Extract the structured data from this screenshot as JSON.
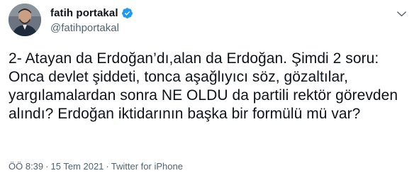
{
  "author": {
    "display_name": "fatih portakal",
    "handle": "@fatihportakal",
    "verified": true,
    "avatar_icon": "profile-photo"
  },
  "tweet": {
    "text": "2- Atayan da Erdoğan’dı,alan da Erdoğan. Şimdi 2 soru: Onca devlet şiddeti, tonca aşağlıyıcı söz, gözaltılar, yargılamalardan sonra NE OLDU da partili rektör görevden alındı? Erdoğan iktidarının başka bir formülü mü var?"
  },
  "meta": {
    "time": "ÖÖ 8:39",
    "separator": "·",
    "date": "15 Tem 2021",
    "source": "Twitter for iPhone"
  },
  "colors": {
    "text": "#0f1419",
    "secondary": "#536471",
    "verified": "#1d9bf0"
  },
  "icons": {
    "verified": "verified-badge-icon",
    "more": "chevron-down-icon"
  }
}
